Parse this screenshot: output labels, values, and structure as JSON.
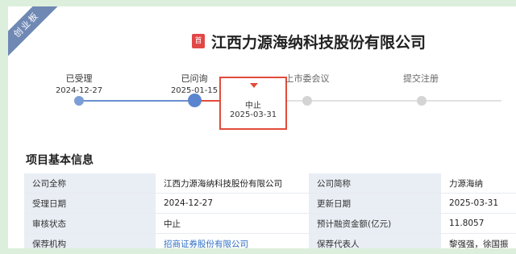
{
  "ribbon": "创业板",
  "header": {
    "badge": "首",
    "title": "江西力源海纳科技股份有限公司"
  },
  "progress": {
    "steps": [
      {
        "label": "已受理",
        "date": "2024-12-27"
      },
      {
        "label": "已问询",
        "date": "2025-01-15"
      },
      {
        "label": "上市委会议",
        "date": ""
      },
      {
        "label": "提交注册",
        "date": ""
      }
    ],
    "halt": {
      "label": "中止",
      "date": "2025-03-31"
    }
  },
  "section": {
    "title": "项目基本信息"
  },
  "info_rows": [
    {
      "k1": "公司全称",
      "v1": "江西力源海纳科技股份有限公司",
      "k2": "公司简称",
      "v2": "力源海纳"
    },
    {
      "k1": "受理日期",
      "v1": "2024-12-27",
      "k2": "更新日期",
      "v2": "2025-03-31"
    },
    {
      "k1": "审核状态",
      "v1": "中止",
      "k2": "预计融资金额(亿元)",
      "v2": "11.8057"
    },
    {
      "k1": "保荐机构",
      "v1": "招商证券股份有限公司",
      "k2": "保荐代表人",
      "v2": "黎强强，徐国振"
    }
  ],
  "colors": {
    "accent_blue": "#6a8fd0",
    "halt_red": "#e24b3b",
    "inactive": "#d4d4d4"
  }
}
